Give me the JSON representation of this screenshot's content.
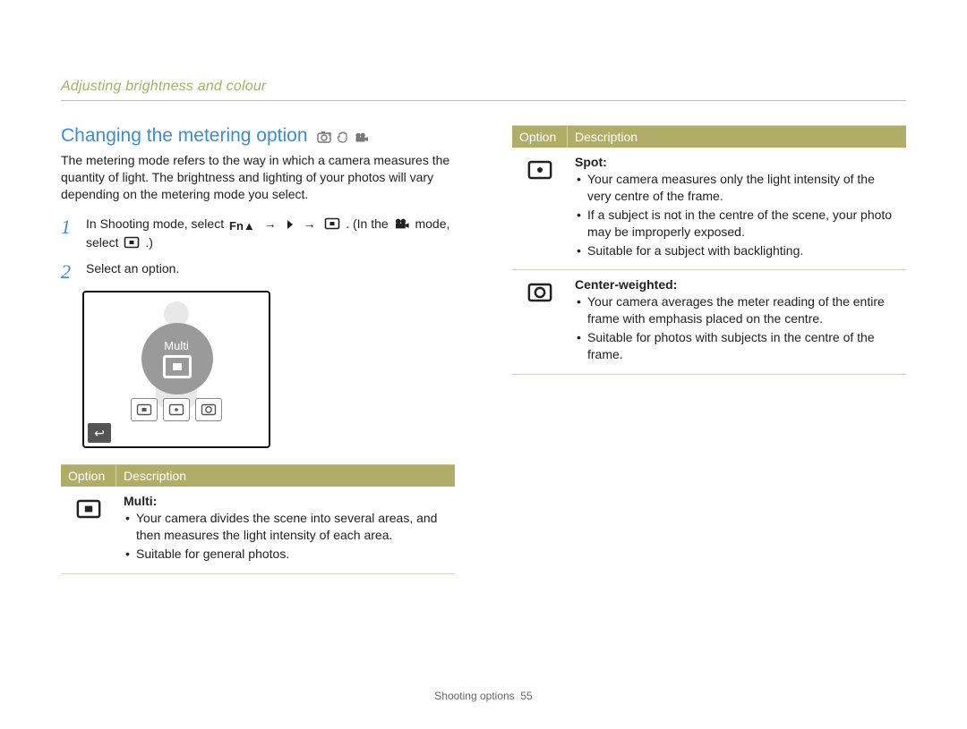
{
  "breadcrumb": "Adjusting brightness and colour",
  "heading": "Changing the metering option",
  "heading_modes": [
    "camera-p",
    "hand",
    "video"
  ],
  "intro": "The metering mode refers to the way in which a camera measures the quantity of light. The brightness and lighting of your photos will vary depending on the metering mode you select.",
  "steps": [
    {
      "num": "1",
      "pre": "In Shooting mode, select ",
      "seq": [
        "Fn▲",
        "→",
        "▶",
        "→",
        "metering-multi-icon"
      ],
      "mid": ". (In the ",
      "mode_icon": "video",
      "post": " mode, select ",
      "end_icon": "metering-multi-icon",
      "tail": ".)"
    },
    {
      "num": "2",
      "text": "Select an option."
    }
  ],
  "lcd": {
    "label": "Multi",
    "back_icon": "↩",
    "chips": [
      "multi",
      "spot",
      "center"
    ]
  },
  "table_header": {
    "c1": "Option",
    "c2": "Description"
  },
  "left_rows": [
    {
      "icon": "multi",
      "title": "Multi",
      "bullets": [
        "Your camera divides the scene into several areas, and then measures the light intensity of each area.",
        "Suitable for general photos."
      ]
    }
  ],
  "right_rows": [
    {
      "icon": "spot",
      "title": "Spot",
      "bullets": [
        "Your camera measures only the light intensity of the very centre of the frame.",
        "If a subject is not in the centre of the scene, your photo may be improperly exposed.",
        "Suitable for a subject with backlighting."
      ]
    },
    {
      "icon": "center",
      "title": "Center-weighted",
      "bullets": [
        "Your camera averages the meter reading of the entire frame with emphasis placed on the centre.",
        "Suitable for photos with subjects in the centre of the frame."
      ]
    }
  ],
  "footer": {
    "section": "Shooting options",
    "page": "55"
  }
}
